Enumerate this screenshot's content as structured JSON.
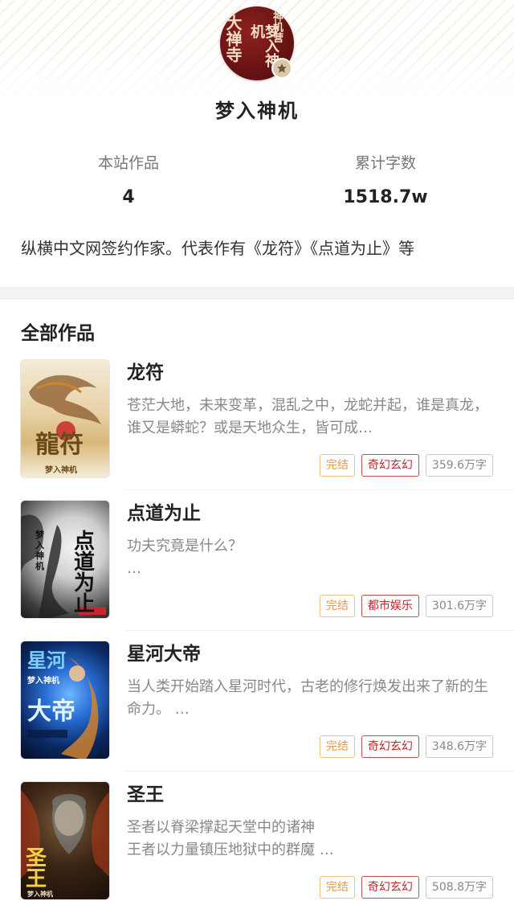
{
  "author": {
    "avatar_text": [
      "大禅寺",
      "梦入神机",
      "神机营"
    ],
    "name": "梦入神机",
    "stats": [
      {
        "label": "本站作品",
        "value": "4"
      },
      {
        "label": "累计字数",
        "value": "1518.7w"
      }
    ],
    "intro": "纵横中文网签约作家。代表作有《龙符》《点道为止》等"
  },
  "works": {
    "title": "全部作品",
    "books": [
      {
        "title": "龙符",
        "desc": "苍茫大地，未来变革，混乱之中，龙蛇并起，谁是真龙，谁又是蟒蛇？或是天地众生，皆可成…",
        "status": "完结",
        "genre": "奇幻玄幻",
        "words": "359.6万字",
        "cover_text": "龍符",
        "cover_author": "梦入神机"
      },
      {
        "title": "点道为止",
        "desc": "功夫究竟是什么？\n…",
        "status": "完结",
        "genre": "都市娱乐",
        "words": "301.6万字",
        "cover_text": "点道为止",
        "cover_author": "梦入神机"
      },
      {
        "title": "星河大帝",
        "desc": "当人类开始踏入星河时代，古老的修行焕发出来了新的生命力。 …",
        "status": "完结",
        "genre": "奇幻玄幻",
        "words": "348.6万字",
        "cover_text": "大帝",
        "cover_author": "梦入神机"
      },
      {
        "title": "圣王",
        "desc": "圣者以脊梁撑起天堂中的诸神\n王者以力量镇压地狱中的群魔 …",
        "status": "完结",
        "genre": "奇幻玄幻",
        "words": "508.8万字",
        "cover_text": "圣王",
        "cover_author": "梦入神机"
      }
    ]
  },
  "colors": {
    "status": "#e59a4e",
    "genre": "#b9262d",
    "avatar": "#6b1414"
  }
}
